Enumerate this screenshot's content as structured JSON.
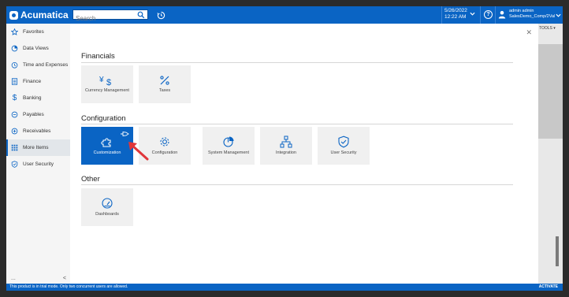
{
  "topbar": {
    "brand": "Acumatica",
    "search_placeholder": "Search",
    "date": "5/26/2022",
    "time": "12:22 AM",
    "user_name": "admin admin",
    "tenant": "SalesDemo_Comp/2Value"
  },
  "sidebar": {
    "items": [
      {
        "label": "Favorites",
        "icon": "star-icon"
      },
      {
        "label": "Data Views",
        "icon": "data-views-icon"
      },
      {
        "label": "Time and Expenses",
        "icon": "clock-icon"
      },
      {
        "label": "Finance",
        "icon": "ledger-icon"
      },
      {
        "label": "Banking",
        "icon": "dollar-icon"
      },
      {
        "label": "Payables",
        "icon": "minus-circle-icon"
      },
      {
        "label": "Receivables",
        "icon": "plus-circle-icon"
      },
      {
        "label": "More Items",
        "icon": "grid-icon",
        "active": true
      },
      {
        "label": "User Security",
        "icon": "shield-icon"
      }
    ],
    "footer_more": "...",
    "footer_collapse": "<"
  },
  "main": {
    "sections": [
      {
        "title": "Financials",
        "tiles": [
          {
            "label": "Currency Management",
            "icon": "currency-icon"
          },
          {
            "label": "Taxes",
            "icon": "percent-icon"
          }
        ]
      },
      {
        "title": "Configuration",
        "tiles": [
          {
            "label": "Customization",
            "icon": "puzzle-icon",
            "selected": true
          },
          {
            "label": "Configuration",
            "icon": "gear-icon"
          },
          {
            "label": "System Management",
            "icon": "pie-icon"
          },
          {
            "label": "Integration",
            "icon": "network-icon"
          },
          {
            "label": "User Security",
            "icon": "shield-check-icon"
          }
        ]
      },
      {
        "title": "Other",
        "tiles": [
          {
            "label": "Dashboards",
            "icon": "gauge-icon"
          }
        ]
      }
    ]
  },
  "right_panel": {
    "tools_label": "TOOLS"
  },
  "bottom_bar": {
    "message": "This product is in trial mode. Only two concurrent users are allowed.",
    "activate": "ACTIVATE"
  },
  "colors": {
    "brand": "#0a64c4",
    "annotation_arrow": "#e0363a"
  }
}
